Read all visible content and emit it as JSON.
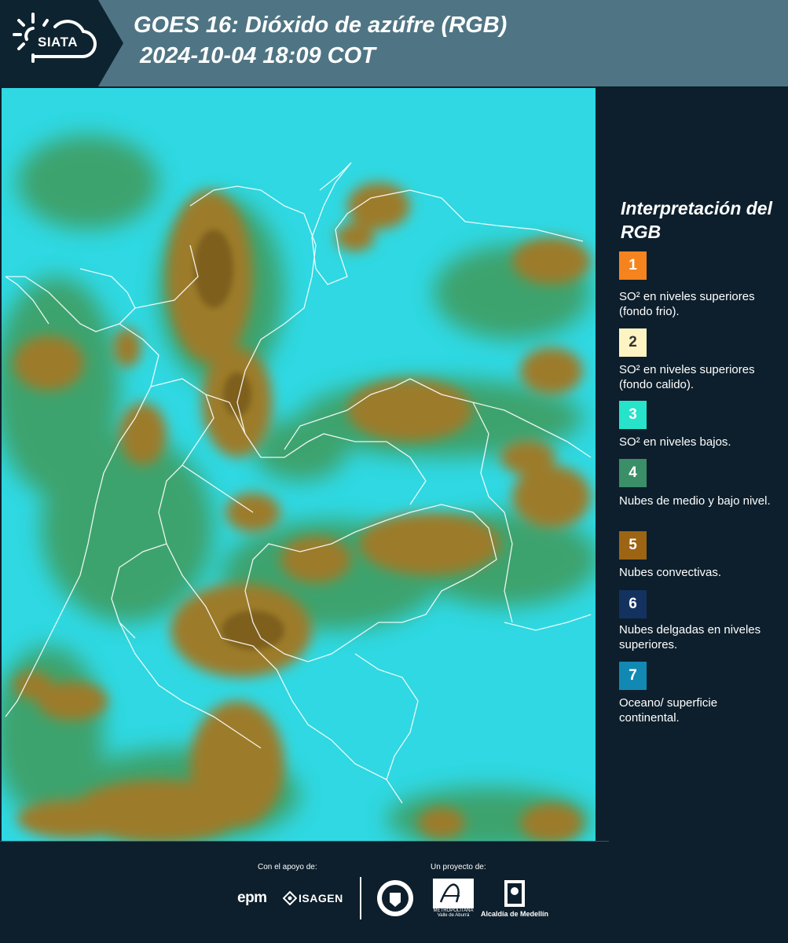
{
  "header": {
    "logo_text": "SIATA",
    "title_line1": "GOES 16: Dióxido de azúfre (RGB)",
    "title_line2": "2024-10-04 18:09 COT"
  },
  "legend": {
    "title": "Interpretación del RGB",
    "items": [
      {
        "number": "1",
        "color": "#f5841f",
        "text": "SO² en niveles superiores (fondo frio)."
      },
      {
        "number": "2",
        "color": "#fdf4c2",
        "text": "SO² en niveles superiores (fondo calido)."
      },
      {
        "number": "3",
        "color": "#27e3c9",
        "text": "SO² en niveles bajos."
      },
      {
        "number": "4",
        "color": "#3a8f68",
        "text": "Nubes de medio y bajo nivel."
      },
      {
        "number": "5",
        "color": "#9d6413",
        "text": "Nubes convectivas."
      },
      {
        "number": "6",
        "color": "#13325f",
        "text": "Nubes delgadas en niveles superiores."
      },
      {
        "number": "7",
        "color": "#1189b3",
        "text": "Oceano/ superficie continental."
      }
    ]
  },
  "footer": {
    "support_label": "Con el apoyo de:",
    "project_label": "Un proyecto de:",
    "sponsor_epm": "epm",
    "sponsor_isagen": "ISAGEN",
    "area_caption": "METROPOLITANA Valle de Aburrá",
    "alcaldia": "Alcaldía de Medellín"
  },
  "colors": {
    "header_bg": "#4f7584",
    "logo_bg": "#0e2330",
    "panel_bg": "#0d1f2c",
    "map_base": "#2fd8e2",
    "cloud_brown": "#9a7a2a",
    "cloud_green": "#3f9a5a"
  }
}
